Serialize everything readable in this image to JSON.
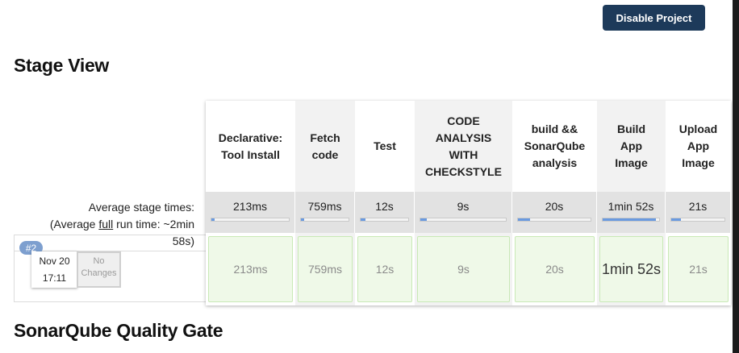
{
  "header": {
    "disable_button": "Disable Project"
  },
  "stage_view": {
    "title": "Stage View",
    "average_label": {
      "line1": "Average stage times:",
      "line2_prefix": "(Average ",
      "line2_underline": "full",
      "line2_suffix": " run time: ~2min",
      "line3": "58s)"
    },
    "stages": [
      {
        "name": "Declarative: Tool Install",
        "avg": "213ms",
        "avg_fraction": 0.04,
        "run": "213ms"
      },
      {
        "name": "Fetch code",
        "avg": "759ms",
        "avg_fraction": 0.06,
        "run": "759ms"
      },
      {
        "name": "Test",
        "avg": "12s",
        "avg_fraction": 0.11,
        "run": "12s"
      },
      {
        "name": "CODE ANALYSIS WITH CHECKSTYLE",
        "avg": "9s",
        "avg_fraction": 0.08,
        "run": "9s"
      },
      {
        "name": "build && SonarQube analysis",
        "avg": "20s",
        "avg_fraction": 0.17,
        "run": "20s"
      },
      {
        "name": "Build App Image",
        "avg": "1min 52s",
        "avg_fraction": 0.94,
        "run": "1min 52s"
      },
      {
        "name": "Upload App Image",
        "avg": "21s",
        "avg_fraction": 0.18,
        "run": "21s"
      }
    ],
    "build": {
      "number": "#2",
      "date": "Nov 20",
      "time": "17:11",
      "changes": "No Changes"
    }
  },
  "sonar_section": {
    "title": "SonarQube Quality Gate"
  }
}
